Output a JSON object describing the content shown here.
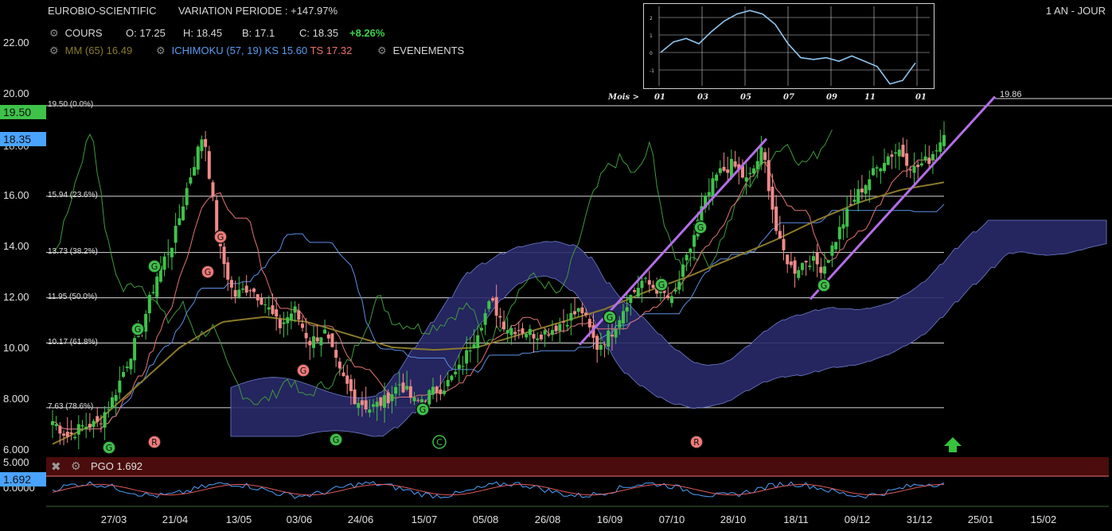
{
  "header": {
    "title": "EUROBIO-SCIENTIFIC",
    "variation": "VARIATION PERIODE : +147.97%",
    "period": "1 AN - JOUR",
    "cours_label": "COURS",
    "open": "O: 17.25",
    "high": "H: 18.45",
    "low": "B: 17.1",
    "close": "C: 18.35",
    "change": "+8.26%",
    "mm_label": "MM (65)",
    "mm_value": "16.49",
    "ichimoku_label": "ICHIMOKU (57, 19)",
    "ks": "KS 15.60",
    "ts": "TS 17.32",
    "events": "EVENEMENTS"
  },
  "tags": {
    "fib_top": "19.50",
    "last": "18.35",
    "pgo": "1.692"
  },
  "y_axis": [
    "22.00",
    "20.00",
    "16.00",
    "14.00",
    "12.00",
    "10.00",
    "8.000",
    "6.000"
  ],
  "y_axis_overlapped": "18.00",
  "pgo": {
    "label": "PGO 1.692",
    "ticks": [
      "5.000",
      "0.0000"
    ]
  },
  "fibonacci": [
    {
      "label": "19.50  (0.0%)",
      "value": 19.5
    },
    {
      "label": "15.94  (23.6%)",
      "value": 15.94
    },
    {
      "label": "13.73  (38.2%)",
      "value": 13.73
    },
    {
      "label": "11.95  (50.0%)",
      "value": 11.95
    },
    {
      "label": "10.17  (61.8%)",
      "value": 10.17
    },
    {
      "label": "7.63  (78.6%)",
      "value": 7.63
    }
  ],
  "projection_label": "19.86",
  "x_axis": [
    "27/03",
    "21/04",
    "13/05",
    "03/06",
    "24/06",
    "15/07",
    "05/08",
    "26/08",
    "16/09",
    "07/10",
    "28/10",
    "18/11",
    "09/12",
    "31/12",
    "25/01",
    "15/02"
  ],
  "inset": {
    "axis_prefix": "Mois >",
    "months": [
      "01",
      "03",
      "05",
      "07",
      "09",
      "11",
      "01"
    ],
    "ticks": [
      "2",
      "1",
      "0",
      "-1"
    ]
  },
  "signals": [
    {
      "letter": "G",
      "kind": "buy"
    },
    {
      "letter": "G",
      "kind": "sell"
    },
    {
      "letter": "R",
      "kind": "sell"
    },
    {
      "letter": "C",
      "kind": "neutral"
    }
  ],
  "colors": {
    "up": "#3fc24a",
    "down": "#f08a8a",
    "ma": "#8a7a2a",
    "kijun": "#5b8fe6",
    "tenkan": "#e57373",
    "chikou": "#3d9a3d",
    "cloud": "#2a2a6a",
    "trend": "#b46ee8",
    "accent_green": "#35c43b",
    "accent_blue": "#4aa3ff"
  },
  "chart_data": {
    "type": "candlestick",
    "title": "EUROBIO-SCIENTIFIC",
    "ylim": [
      6,
      22.5
    ],
    "last_close": 18.35,
    "ohlc_anchor_path": [
      7.1,
      6.5,
      6.9,
      7.0,
      8.0,
      9.5,
      11.0,
      13.0,
      14.2,
      16.5,
      18.5,
      14.0,
      12.0,
      12.4,
      11.8,
      10.8,
      11.5,
      10.2,
      10.6,
      9.0,
      8.0,
      7.6,
      7.9,
      8.6,
      7.8,
      8.2,
      8.5,
      9.2,
      10.5,
      11.8,
      10.8,
      10.7,
      10.5,
      10.7,
      11.1,
      11.5,
      10.0,
      10.6,
      11.8,
      12.6,
      12.3,
      11.8,
      13.5,
      15.5,
      16.8,
      17.2,
      16.5,
      17.8,
      14.2,
      13.0,
      13.5,
      13.1,
      14.5,
      15.8,
      16.6,
      17.4,
      17.8,
      17.0,
      17.4,
      18.35
    ],
    "moving_average_65": [
      6.2,
      7.0,
      8.5,
      10.0,
      11.0,
      11.2,
      11.0,
      10.5,
      10.0,
      9.9,
      10.0,
      10.5,
      11.0,
      11.5,
      12.2,
      12.8,
      13.5,
      14.2,
      15.0,
      15.7,
      16.2,
      16.49
    ],
    "pgo": {
      "last": 1.692,
      "range": [
        -5,
        5
      ]
    }
  }
}
